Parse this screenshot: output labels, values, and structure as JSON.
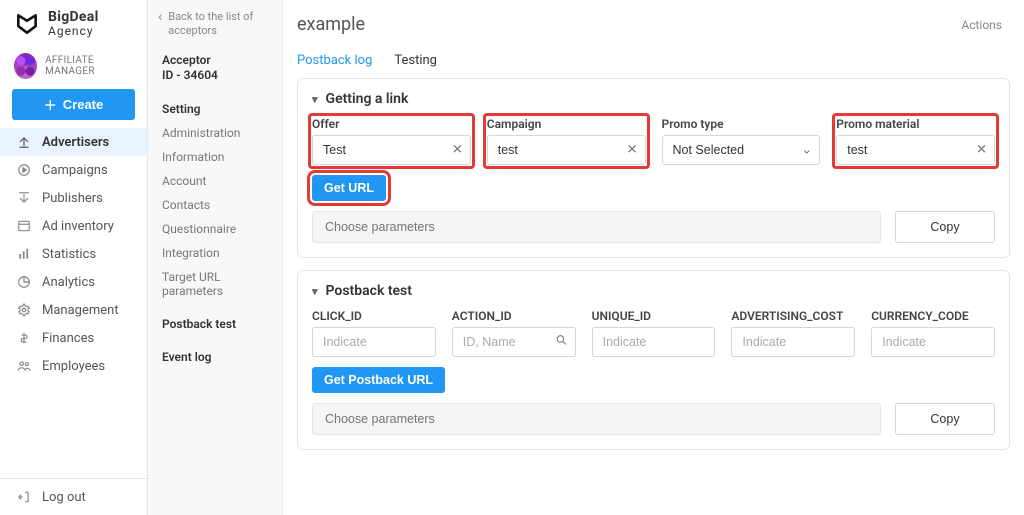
{
  "brand": {
    "line1": "BigDeal",
    "line2": "Agency"
  },
  "affiliate_label": "AFFILIATE MANAGER",
  "create_label": "Create",
  "nav": {
    "advertisers": "Advertisers",
    "campaigns": "Campaigns",
    "publishers": "Publishers",
    "ad_inventory": "Ad inventory",
    "statistics": "Statistics",
    "analytics": "Analytics",
    "management": "Management",
    "finances": "Finances",
    "employees": "Employees",
    "logout": "Log out"
  },
  "back_label": "Back to the list of acceptors",
  "acceptor_id": {
    "line1": "Acceptor",
    "line2": "ID - 34604"
  },
  "subnav": {
    "setting": "Setting",
    "administration": "Administration",
    "information": "Information",
    "account": "Account",
    "contacts": "Contacts",
    "questionnaire": "Questionnaire",
    "integration": "Integration",
    "target_url": "Target URL parameters",
    "postback_test": "Postback test",
    "event_log": "Event log"
  },
  "page_title": "example",
  "actions_label": "Actions",
  "tabs": {
    "postback_log": "Postback log",
    "testing": "Testing"
  },
  "section_link": {
    "title": "Getting a link",
    "offer_label": "Offer",
    "offer_value": "Test",
    "campaign_label": "Campaign",
    "campaign_value": "test",
    "promo_type_label": "Promo type",
    "promo_type_value": "Not Selected",
    "promo_material_label": "Promo material",
    "promo_material_value": "test",
    "get_url": "Get URL",
    "params_placeholder": "Choose parameters",
    "copy": "Copy"
  },
  "section_postback": {
    "title": "Postback test",
    "click_id": "CLICK_ID",
    "action_id": "ACTION_ID",
    "unique_id": "UNIQUE_ID",
    "adv_cost": "ADVERTISING_COST",
    "currency": "CURRENCY_CODE",
    "indicate_ph": "Indicate",
    "idname_ph": "ID, Name",
    "get_postback": "Get Postback URL",
    "params_placeholder": "Choose parameters",
    "copy": "Copy"
  }
}
